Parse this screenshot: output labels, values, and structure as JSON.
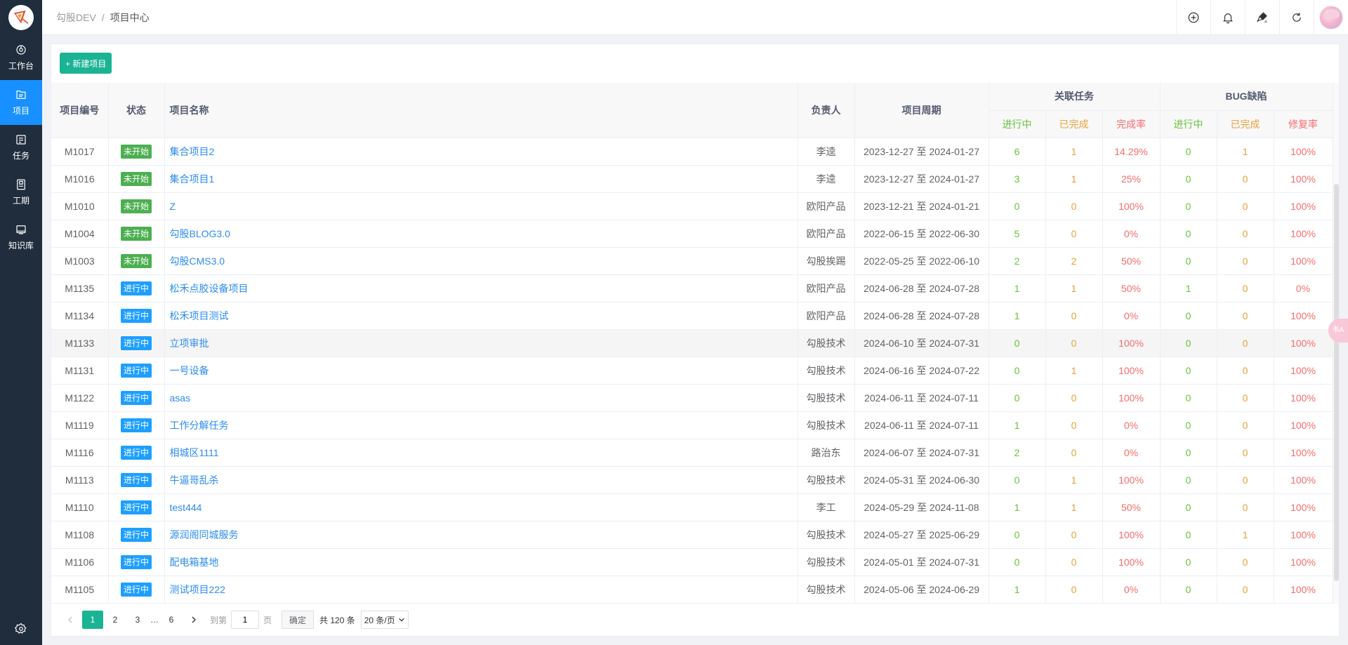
{
  "nav": {
    "items": [
      {
        "label": "工作台",
        "icon": "dashboard-icon"
      },
      {
        "label": "项目",
        "icon": "project-icon"
      },
      {
        "label": "任务",
        "icon": "task-icon"
      },
      {
        "label": "工期",
        "icon": "schedule-icon"
      },
      {
        "label": "知识库",
        "icon": "knowledge-icon"
      }
    ]
  },
  "header": {
    "breadcrumb_root": "勾股DEV",
    "breadcrumb_sep": "/",
    "breadcrumb_current": "项目中心"
  },
  "toolbar": {
    "new_project": "+ 新建项目"
  },
  "table": {
    "headers": {
      "code": "项目编号",
      "status": "状态",
      "name": "项目名称",
      "owner": "负责人",
      "period": "项目周期",
      "task_group": "关联任务",
      "bug_group": "BUG缺陷",
      "in_progress": "进行中",
      "done": "已完成",
      "rate": "完成率",
      "fix_rate": "修复率"
    },
    "rows": [
      {
        "code": "M1017",
        "status": "未开始",
        "status_color": "green",
        "name": "集合项目2",
        "owner": "李逵",
        "period": "2023-12-27 至 2024-01-27",
        "t_doing": "6",
        "t_done": "1",
        "t_rate": "14.29%",
        "b_doing": "0",
        "b_done": "1",
        "b_rate": "100%"
      },
      {
        "code": "M1016",
        "status": "未开始",
        "status_color": "green",
        "name": "集合项目1",
        "owner": "李逵",
        "period": "2023-12-27 至 2024-01-27",
        "t_doing": "3",
        "t_done": "1",
        "t_rate": "25%",
        "b_doing": "0",
        "b_done": "0",
        "b_rate": "100%"
      },
      {
        "code": "M1010",
        "status": "未开始",
        "status_color": "green",
        "name": "Z",
        "owner": "欧阳产品",
        "period": "2023-12-21 至 2024-01-21",
        "t_doing": "0",
        "t_done": "0",
        "t_rate": "100%",
        "b_doing": "0",
        "b_done": "0",
        "b_rate": "100%"
      },
      {
        "code": "M1004",
        "status": "未开始",
        "status_color": "green",
        "name": "勾股BLOG3.0",
        "owner": "欧阳产品",
        "period": "2022-06-15 至 2022-06-30",
        "t_doing": "5",
        "t_done": "0",
        "t_rate": "0%",
        "b_doing": "0",
        "b_done": "0",
        "b_rate": "100%"
      },
      {
        "code": "M1003",
        "status": "未开始",
        "status_color": "green",
        "name": "勾股CMS3.0",
        "owner": "勾股挨踢",
        "period": "2022-05-25 至 2022-06-10",
        "t_doing": "2",
        "t_done": "2",
        "t_rate": "50%",
        "b_doing": "0",
        "b_done": "0",
        "b_rate": "100%"
      },
      {
        "code": "M1135",
        "status": "进行中",
        "status_color": "blue",
        "name": "松禾点胶设备项目",
        "owner": "欧阳产品",
        "period": "2024-06-28 至 2024-07-28",
        "t_doing": "1",
        "t_done": "1",
        "t_rate": "50%",
        "b_doing": "1",
        "b_done": "0",
        "b_rate": "0%"
      },
      {
        "code": "M1134",
        "status": "进行中",
        "status_color": "blue",
        "name": "松禾项目测试",
        "owner": "欧阳产品",
        "period": "2024-06-28 至 2024-07-28",
        "t_doing": "1",
        "t_done": "0",
        "t_rate": "0%",
        "b_doing": "0",
        "b_done": "0",
        "b_rate": "100%"
      },
      {
        "code": "M1133",
        "status": "进行中",
        "status_color": "blue",
        "name": "立项审批",
        "owner": "勾股技术",
        "period": "2024-06-10 至 2024-07-31",
        "t_doing": "0",
        "t_done": "0",
        "t_rate": "100%",
        "b_doing": "0",
        "b_done": "0",
        "b_rate": "100%"
      },
      {
        "code": "M1131",
        "status": "进行中",
        "status_color": "blue",
        "name": "一号设备",
        "owner": "勾股技术",
        "period": "2024-06-16 至 2024-07-22",
        "t_doing": "0",
        "t_done": "1",
        "t_rate": "100%",
        "b_doing": "0",
        "b_done": "0",
        "b_rate": "100%"
      },
      {
        "code": "M1122",
        "status": "进行中",
        "status_color": "blue",
        "name": "asas",
        "owner": "勾股技术",
        "period": "2024-06-11 至 2024-07-11",
        "t_doing": "0",
        "t_done": "0",
        "t_rate": "100%",
        "b_doing": "0",
        "b_done": "0",
        "b_rate": "100%"
      },
      {
        "code": "M1119",
        "status": "进行中",
        "status_color": "blue",
        "name": "工作分解任务",
        "owner": "勾股技术",
        "period": "2024-06-11 至 2024-07-11",
        "t_doing": "1",
        "t_done": "0",
        "t_rate": "0%",
        "b_doing": "0",
        "b_done": "0",
        "b_rate": "100%"
      },
      {
        "code": "M1116",
        "status": "进行中",
        "status_color": "blue",
        "name": "相城区1111",
        "owner": "路治东",
        "period": "2024-06-07 至 2024-07-31",
        "t_doing": "2",
        "t_done": "0",
        "t_rate": "0%",
        "b_doing": "0",
        "b_done": "0",
        "b_rate": "100%"
      },
      {
        "code": "M1113",
        "status": "进行中",
        "status_color": "blue",
        "name": "牛逼哥乱杀",
        "owner": "勾股技术",
        "period": "2024-05-31 至 2024-06-30",
        "t_doing": "0",
        "t_done": "1",
        "t_rate": "100%",
        "b_doing": "0",
        "b_done": "0",
        "b_rate": "100%"
      },
      {
        "code": "M1110",
        "status": "进行中",
        "status_color": "blue",
        "name": "test444",
        "owner": "李工",
        "period": "2024-05-29 至 2024-11-08",
        "t_doing": "1",
        "t_done": "1",
        "t_rate": "50%",
        "b_doing": "0",
        "b_done": "0",
        "b_rate": "100%"
      },
      {
        "code": "M1108",
        "status": "进行中",
        "status_color": "blue",
        "name": "源润阁同城服务",
        "owner": "勾股技术",
        "period": "2024-05-27 至 2025-06-29",
        "t_doing": "0",
        "t_done": "0",
        "t_rate": "100%",
        "b_doing": "0",
        "b_done": "1",
        "b_rate": "100%"
      },
      {
        "code": "M1106",
        "status": "进行中",
        "status_color": "blue",
        "name": "配电箱基地",
        "owner": "勾股技术",
        "period": "2024-05-01 至 2024-07-31",
        "t_doing": "0",
        "t_done": "0",
        "t_rate": "100%",
        "b_doing": "0",
        "b_done": "0",
        "b_rate": "100%"
      },
      {
        "code": "M1105",
        "status": "进行中",
        "status_color": "blue",
        "name": "测试项目222",
        "owner": "勾股技术",
        "period": "2024-05-06 至 2024-06-29",
        "t_doing": "1",
        "t_done": "0",
        "t_rate": "0%",
        "b_doing": "0",
        "b_done": "0",
        "b_rate": "100%"
      }
    ]
  },
  "pagination": {
    "pages": [
      "1",
      "2",
      "3",
      "…",
      "6"
    ],
    "current": "1",
    "goto_label": "到第",
    "goto_value": "1",
    "page_unit": "页",
    "confirm": "确定",
    "total": "共 120 条",
    "page_size": "20 条/页"
  },
  "float_badge": "韦A",
  "colors": {
    "sidebar_bg": "#1f2d3d",
    "nav_active": "#1890ff",
    "primary": "#1ab394",
    "link": "#2d8cf0",
    "green": "#67c23a",
    "orange": "#e6a23c",
    "red": "#f56c6c"
  }
}
